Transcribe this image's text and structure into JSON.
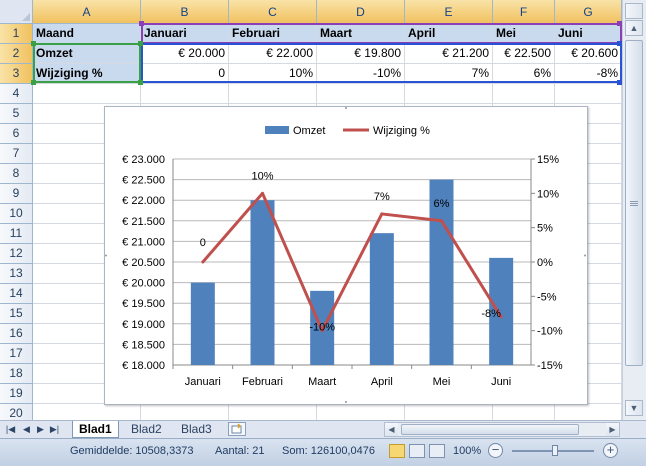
{
  "sheet": {
    "columns": [
      "A",
      "B",
      "C",
      "D",
      "E",
      "F",
      "G"
    ],
    "rows": [
      "1",
      "2",
      "3",
      "4",
      "5",
      "6",
      "7",
      "8",
      "9",
      "10",
      "11",
      "12",
      "13",
      "14",
      "15",
      "16",
      "17",
      "18",
      "19",
      "20"
    ],
    "cells": {
      "r1": [
        "Maand",
        "Januari",
        "Februari",
        "Maart",
        "April",
        "Mei",
        "Juni"
      ],
      "r2": [
        "Omzet",
        "€ 20.000",
        "€ 22.000",
        "€ 19.800",
        "€ 21.200",
        "€ 22.500",
        "€ 20.600"
      ],
      "r3": [
        "Wijziging %",
        "0",
        "10%",
        "-10%",
        "7%",
        "6%",
        "-8%"
      ]
    }
  },
  "chart_data": {
    "type": "bar",
    "categories": [
      "Januari",
      "Februari",
      "Maart",
      "April",
      "Mei",
      "Juni"
    ],
    "series": [
      {
        "name": "Omzet",
        "type": "bar",
        "axis": "left",
        "color": "#4f81bd",
        "values": [
          20000,
          22000,
          19800,
          21200,
          22500,
          20600
        ]
      },
      {
        "name": "Wijziging %",
        "type": "line",
        "axis": "right",
        "color": "#c0504d",
        "values": [
          0,
          10,
          -10,
          7,
          6,
          -8
        ]
      }
    ],
    "data_labels": [
      "0",
      "10%",
      "-10%",
      "7%",
      "6%",
      "-8%"
    ],
    "left_axis": {
      "min": 18000,
      "max": 23000,
      "step": 500,
      "tick_labels": [
        "€ 23.000",
        "€ 22.500",
        "€ 22.000",
        "€ 21.500",
        "€ 21.000",
        "€ 20.500",
        "€ 20.000",
        "€ 19.500",
        "€ 19.000",
        "€ 18.500",
        "€ 18.000"
      ]
    },
    "right_axis": {
      "min": -15,
      "max": 15,
      "step": 5,
      "tick_labels": [
        "15%",
        "10%",
        "5%",
        "0%",
        "-5%",
        "-10%",
        "-15%"
      ]
    },
    "grid": true,
    "legend": "top"
  },
  "tabs": {
    "nav_icons": [
      "first-sheet-icon",
      "prev-sheet-icon",
      "next-sheet-icon",
      "last-sheet-icon"
    ],
    "sheets": [
      "Blad1",
      "Blad2",
      "Blad3"
    ],
    "active": "Blad1",
    "insert_icon": "insert-sheet-icon"
  },
  "status": {
    "average": "Gemiddelde: 10508,3373",
    "count": "Aantal: 21",
    "sum": "Som: 126100,0476",
    "zoom": "100%",
    "zoom_out": "−",
    "zoom_in": "+"
  }
}
